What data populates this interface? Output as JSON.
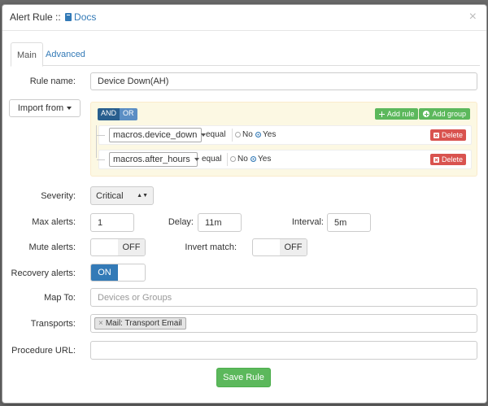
{
  "header": {
    "title": "Alert Rule ::",
    "docs_link": "Docs",
    "close_glyph": "×"
  },
  "tabs": [
    {
      "label": "Main",
      "active": true
    },
    {
      "label": "Advanced",
      "active": false
    }
  ],
  "form": {
    "rule_name_label": "Rule name:",
    "rule_name_value": "Device Down(AH)",
    "import_from_label": "Import from",
    "severity_label": "Severity:",
    "severity_value": "Critical",
    "max_alerts_label": "Max alerts:",
    "max_alerts_value": "1",
    "delay_label": "Delay:",
    "delay_value": "11m",
    "interval_label": "Interval:",
    "interval_value": "5m",
    "mute_alerts_label": "Mute alerts:",
    "mute_alerts_state": "OFF",
    "invert_match_label": "Invert match:",
    "invert_match_state": "OFF",
    "recovery_alerts_label": "Recovery alerts:",
    "recovery_alerts_state": "ON",
    "map_to_label": "Map To:",
    "map_to_placeholder": "Devices or Groups",
    "transports_label": "Transports:",
    "transports_tag": "Mail: Transport Email",
    "transports_tag_remove": "×",
    "procedure_url_label": "Procedure URL:",
    "procedure_url_value": "",
    "save_label": "Save Rule"
  },
  "query_builder": {
    "and_label": "AND",
    "or_label": "OR",
    "add_rule_label": "Add rule",
    "add_group_label": "Add group",
    "rules": [
      {
        "field": "macros.device_down",
        "operator": "equal",
        "no_label": "No",
        "yes_label": "Yes",
        "selected": "Yes",
        "delete_label": "Delete"
      },
      {
        "field": "macros.after_hours",
        "operator": "equal",
        "no_label": "No",
        "yes_label": "Yes",
        "selected": "Yes",
        "delete_label": "Delete"
      }
    ]
  },
  "colors": {
    "primary": "#337ab7",
    "success": "#5cb85c",
    "danger": "#d9534f",
    "warning_bg": "#fcf8e3"
  },
  "icons": [
    "book-icon",
    "close-icon",
    "caret-down-icon",
    "plus-icon",
    "plus-circle-icon",
    "x-icon"
  ]
}
